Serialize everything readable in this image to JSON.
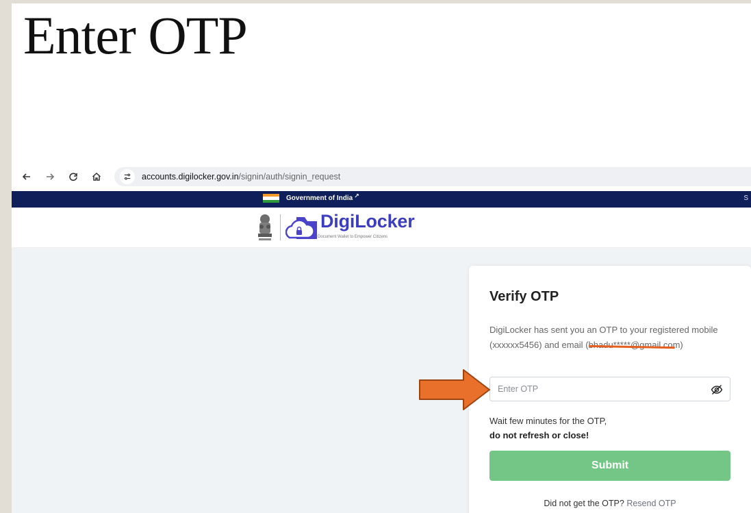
{
  "slide": {
    "title": "Enter OTP"
  },
  "browser": {
    "url_host": "accounts.digilocker.gov.in",
    "url_path": "/signin/auth/signin_request",
    "icons": [
      "back-arrow-icon",
      "forward-arrow-icon",
      "reload-icon",
      "home-icon",
      "site-settings-icon"
    ]
  },
  "gov_strip": {
    "label": "Government of India",
    "right_text": "S",
    "color": "#0f1f5a"
  },
  "header": {
    "brand": "DigiLocker",
    "tagline": "Document Wallet to Empower Citizens",
    "brand_color": "#3d3ebf"
  },
  "card": {
    "title": "Verify OTP",
    "description": "DigiLocker has sent you an OTP to your registered mobile (xxxxxx5456) and email",
    "email_open": "(",
    "email": "bhadu*****@gmail.com",
    "email_close": ")",
    "otp_placeholder": "Enter OTP",
    "wait_line": "Wait few minutes for the OTP,",
    "wait_bold": "do not refresh or close!",
    "submit_label": "Submit",
    "submit_color": "#74c686",
    "resend_prompt": "Did not get the OTP?",
    "resend_link": "Resend OTP"
  },
  "annotation": {
    "arrow_color": "#e8702a",
    "strike_color": "#e55d1f"
  }
}
